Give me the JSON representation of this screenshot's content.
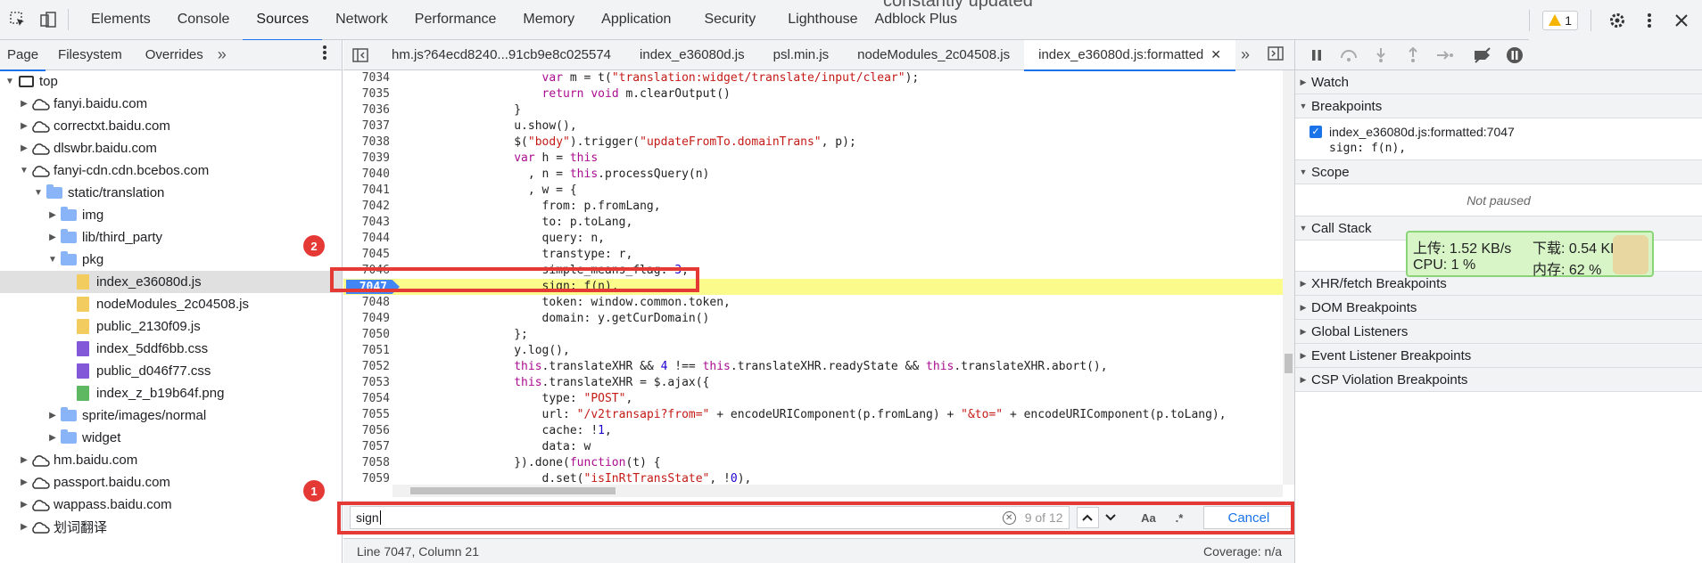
{
  "background_text": "constantly updated",
  "toolbar": {
    "tabs": [
      "Elements",
      "Console",
      "Sources",
      "Network",
      "Performance",
      "Memory",
      "Application",
      "Security",
      "Lighthouse",
      "Adblock Plus"
    ],
    "active_tab": "Sources",
    "warning_count": "1"
  },
  "navigator": {
    "tabs": [
      "Page",
      "Filesystem",
      "Overrides"
    ],
    "more": "»",
    "tree": [
      {
        "label": "top",
        "type": "frame",
        "depth": 0,
        "expanded": true
      },
      {
        "label": "fanyi.baidu.com",
        "type": "cloud",
        "depth": 1,
        "expanded": false
      },
      {
        "label": "correctxt.baidu.com",
        "type": "cloud",
        "depth": 1,
        "expanded": false
      },
      {
        "label": "dlswbr.baidu.com",
        "type": "cloud",
        "depth": 1,
        "expanded": false
      },
      {
        "label": "fanyi-cdn.cdn.bcebos.com",
        "type": "cloud",
        "depth": 1,
        "expanded": true
      },
      {
        "label": "static/translation",
        "type": "folder",
        "depth": 2,
        "expanded": true
      },
      {
        "label": "img",
        "type": "folder",
        "depth": 3,
        "expanded": false
      },
      {
        "label": "lib/third_party",
        "type": "folder",
        "depth": 3,
        "expanded": false
      },
      {
        "label": "pkg",
        "type": "folder",
        "depth": 3,
        "expanded": true
      },
      {
        "label": "index_e36080d.js",
        "type": "js",
        "depth": 4,
        "selected": true
      },
      {
        "label": "nodeModules_2c04508.js",
        "type": "js",
        "depth": 4
      },
      {
        "label": "public_2130f09.js",
        "type": "js",
        "depth": 4
      },
      {
        "label": "index_5ddf6bb.css",
        "type": "css",
        "depth": 4
      },
      {
        "label": "public_d046f77.css",
        "type": "css",
        "depth": 4
      },
      {
        "label": "index_z_b19b64f.png",
        "type": "png",
        "depth": 4
      },
      {
        "label": "sprite/images/normal",
        "type": "folder",
        "depth": 3,
        "expanded": false
      },
      {
        "label": "widget",
        "type": "folder",
        "depth": 3,
        "expanded": false
      },
      {
        "label": "hm.baidu.com",
        "type": "cloud",
        "depth": 1,
        "expanded": false
      },
      {
        "label": "passport.baidu.com",
        "type": "cloud",
        "depth": 1,
        "expanded": false
      },
      {
        "label": "wappass.baidu.com",
        "type": "cloud",
        "depth": 1,
        "expanded": false
      },
      {
        "label": "划词翻译",
        "type": "cloud",
        "depth": 1,
        "expanded": false
      }
    ],
    "annotation_1": "1",
    "annotation_2": "2"
  },
  "editor": {
    "tabs": [
      {
        "label": "hm.js?64ecd8240...91cb9e8c025574",
        "active": false
      },
      {
        "label": "index_e36080d.js",
        "active": false
      },
      {
        "label": "psl.min.js",
        "active": false
      },
      {
        "label": "nodeModules_2c04508.js",
        "active": false
      },
      {
        "label": "index_e36080d.js:formatted",
        "active": true,
        "closable": true
      }
    ],
    "more": "»",
    "lines": [
      {
        "n": "7034",
        "code": "                    var m = t(\"translation:widget/translate/input/clear\");"
      },
      {
        "n": "7035",
        "code": "                    return void m.clearOutput()"
      },
      {
        "n": "7036",
        "code": "                }"
      },
      {
        "n": "7037",
        "code": "                u.show(),"
      },
      {
        "n": "7038",
        "code": "                $(\"body\").trigger(\"updateFromTo.domainTrans\", p);"
      },
      {
        "n": "7039",
        "code": "                var h = this"
      },
      {
        "n": "7040",
        "code": "                  , n = this.processQuery(n)"
      },
      {
        "n": "7041",
        "code": "                  , w = {"
      },
      {
        "n": "7042",
        "code": "                    from: p.fromLang,"
      },
      {
        "n": "7043",
        "code": "                    to: p.toLang,"
      },
      {
        "n": "7044",
        "code": "                    query: n,"
      },
      {
        "n": "7045",
        "code": "                    transtype: r,"
      },
      {
        "n": "7046",
        "code": "                    simple_means_flag: 3,"
      },
      {
        "n": "7047",
        "code": "                    sign: f(n),",
        "highlight": true,
        "breakpoint": true
      },
      {
        "n": "7048",
        "code": "                    token: window.common.token,"
      },
      {
        "n": "7049",
        "code": "                    domain: y.getCurDomain()"
      },
      {
        "n": "7050",
        "code": "                };"
      },
      {
        "n": "7051",
        "code": "                y.log(),"
      },
      {
        "n": "7052",
        "code": "                this.translateXHR && 4 !== this.translateXHR.readyState && this.translateXHR.abort(),"
      },
      {
        "n": "7053",
        "code": "                this.translateXHR = $.ajax({"
      },
      {
        "n": "7054",
        "code": "                    type: \"POST\","
      },
      {
        "n": "7055",
        "code": "                    url: \"/v2transapi?from=\" + encodeURIComponent(p.fromLang) + \"&to=\" + encodeURIComponent(p.toLang),"
      },
      {
        "n": "7056",
        "code": "                    cache: !1,"
      },
      {
        "n": "7057",
        "code": "                    data: w"
      },
      {
        "n": "7058",
        "code": "                }).done(function(t) {"
      },
      {
        "n": "7059",
        "code": "                    d.set(\"isInRtTransState\", !0),"
      },
      {
        "n": "7060",
        "code": ""
      }
    ]
  },
  "search": {
    "value": "sign",
    "count": "9 of 12",
    "match_case": "Aa",
    "regex": ".*",
    "cancel": "Cancel"
  },
  "status": {
    "position": "Line 7047, Column 21",
    "coverage": "Coverage: n/a"
  },
  "debugger": {
    "sections": {
      "watch": "Watch",
      "breakpoints": "Breakpoints",
      "scope": "Scope",
      "call_stack": "Call Stack",
      "xhr": "XHR/fetch Breakpoints",
      "dom": "DOM Breakpoints",
      "global": "Global Listeners",
      "event": "Event Listener Breakpoints",
      "csp": "CSP Violation Breakpoints"
    },
    "breakpoint_file": "index_e36080d.js:formatted:7047",
    "breakpoint_code": "sign: f(n),",
    "not_paused": "Not paused",
    "not_paused_2": "Not paused"
  },
  "net_widget": {
    "upload": "上传: 1.52 KB/s",
    "download": "下载: 0.54 KB/s",
    "cpu": "CPU: 1 %",
    "memory": "内存: 62 %"
  }
}
